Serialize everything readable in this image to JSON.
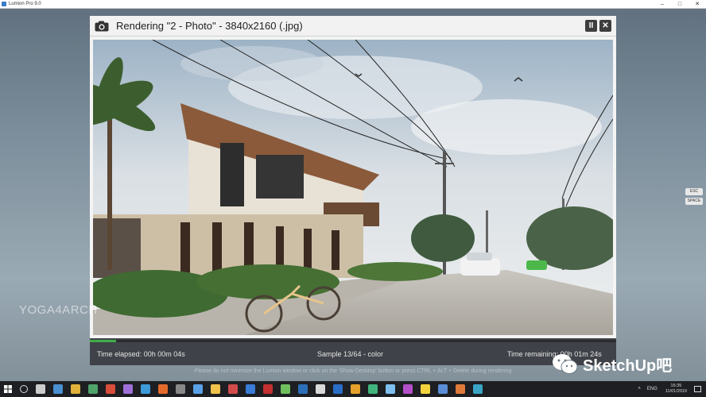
{
  "app": {
    "title": "Lumion Pro 9.0",
    "window_controls": {
      "minimize": "–",
      "maximize": "□",
      "close": "✕"
    }
  },
  "dialog": {
    "title": "Rendering \"2 - Photo\" - 3840x2160 (.jpg)",
    "camera_icon": "camera-icon",
    "pause_label": "II",
    "close_label": "✕"
  },
  "status": {
    "elapsed": "Time elapsed: 00h 00m 04s",
    "sample": "Sample 13/64 - color",
    "remaining": "Time remaining: 00h 01m 24s",
    "progress_fraction": 0.05,
    "progress_color": "#3fae49"
  },
  "hint": "Please do not minimize the Lumion window or click on the 'Show Desktop' button or press CTRL + ALT + Delete during rendering",
  "watermarks": {
    "left": "YOGA4ARCH",
    "right": "SketchUp吧"
  },
  "keys": [
    "ESC",
    "SPACE"
  ],
  "taskbar": {
    "apps": [
      {
        "icon": "task-view-icon",
        "color": "#cccccc"
      },
      {
        "icon": "app-icon-1",
        "color": "#4a8fd0"
      },
      {
        "icon": "chrome-icon",
        "color": "#e0b23a"
      },
      {
        "icon": "app-icon-3",
        "color": "#4fa36b"
      },
      {
        "icon": "app-icon-4",
        "color": "#d84c3b"
      },
      {
        "icon": "app-icon-5",
        "color": "#9e6fd8"
      },
      {
        "icon": "app-icon-6",
        "color": "#3d9ad8"
      },
      {
        "icon": "app-icon-7",
        "color": "#e56b2c"
      },
      {
        "icon": "app-icon-8",
        "color": "#888888"
      },
      {
        "icon": "app-icon-9",
        "color": "#5aa0e6"
      },
      {
        "icon": "explorer-icon",
        "color": "#f0c24a"
      },
      {
        "icon": "app-icon-11",
        "color": "#d14b4b"
      },
      {
        "icon": "app-icon-12",
        "color": "#3a7bd5"
      },
      {
        "icon": "app-icon-13",
        "color": "#c43030"
      },
      {
        "icon": "app-icon-14",
        "color": "#6fbf5f"
      },
      {
        "icon": "app-icon-15",
        "color": "#2c6fb8"
      },
      {
        "icon": "app-icon-16",
        "color": "#d9d9d9"
      },
      {
        "icon": "photoshop-icon",
        "color": "#2b6ec7"
      },
      {
        "icon": "app-icon-18",
        "color": "#e5a12c"
      },
      {
        "icon": "app-icon-19",
        "color": "#3fb47b"
      },
      {
        "icon": "app-icon-20",
        "color": "#7fbfef"
      },
      {
        "icon": "app-icon-21",
        "color": "#b44fc9"
      },
      {
        "icon": "app-icon-22",
        "color": "#f2d33c"
      },
      {
        "icon": "app-icon-23",
        "color": "#5b8dd6"
      },
      {
        "icon": "app-icon-24",
        "color": "#e07a3b"
      },
      {
        "icon": "app-icon-25",
        "color": "#3aa4c4"
      }
    ],
    "tray": {
      "language": "ENG",
      "time": "16:35",
      "date": "11/01/2019"
    }
  }
}
